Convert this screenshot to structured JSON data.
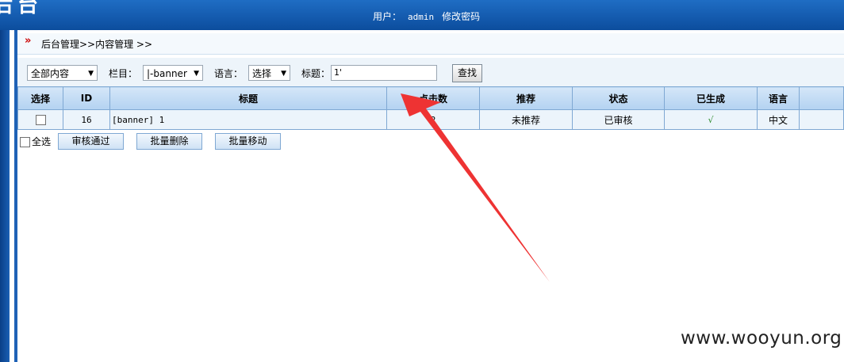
{
  "header": {
    "title": "后台",
    "user_label": "用户：",
    "username": "admin",
    "change_password": "修改密码"
  },
  "breadcrumb": {
    "text": "后台管理>>内容管理 >>"
  },
  "filters": {
    "content_select": "全部内容",
    "column_label": "栏目：",
    "column_select": "|-banner",
    "language_label": "语言：",
    "language_select": "选择",
    "title_label": "标题：",
    "title_value": "1'",
    "search_button": "查找"
  },
  "table": {
    "headers": [
      "选择",
      "ID",
      "标题",
      "点击数",
      "推荐",
      "状态",
      "已生成",
      "语言"
    ],
    "rows": [
      {
        "id": "16",
        "title": "[banner] 1",
        "hits": "2",
        "recommend": "未推荐",
        "status": "已审核",
        "generated": "√",
        "language": "中文"
      }
    ]
  },
  "actions": {
    "select_all": "全选",
    "approve": "审核通过",
    "batch_delete": "批量删除",
    "batch_move": "批量移动"
  },
  "annotation": {
    "arrow_color": "#ee3333"
  },
  "watermark": "www.wooyun.org"
}
